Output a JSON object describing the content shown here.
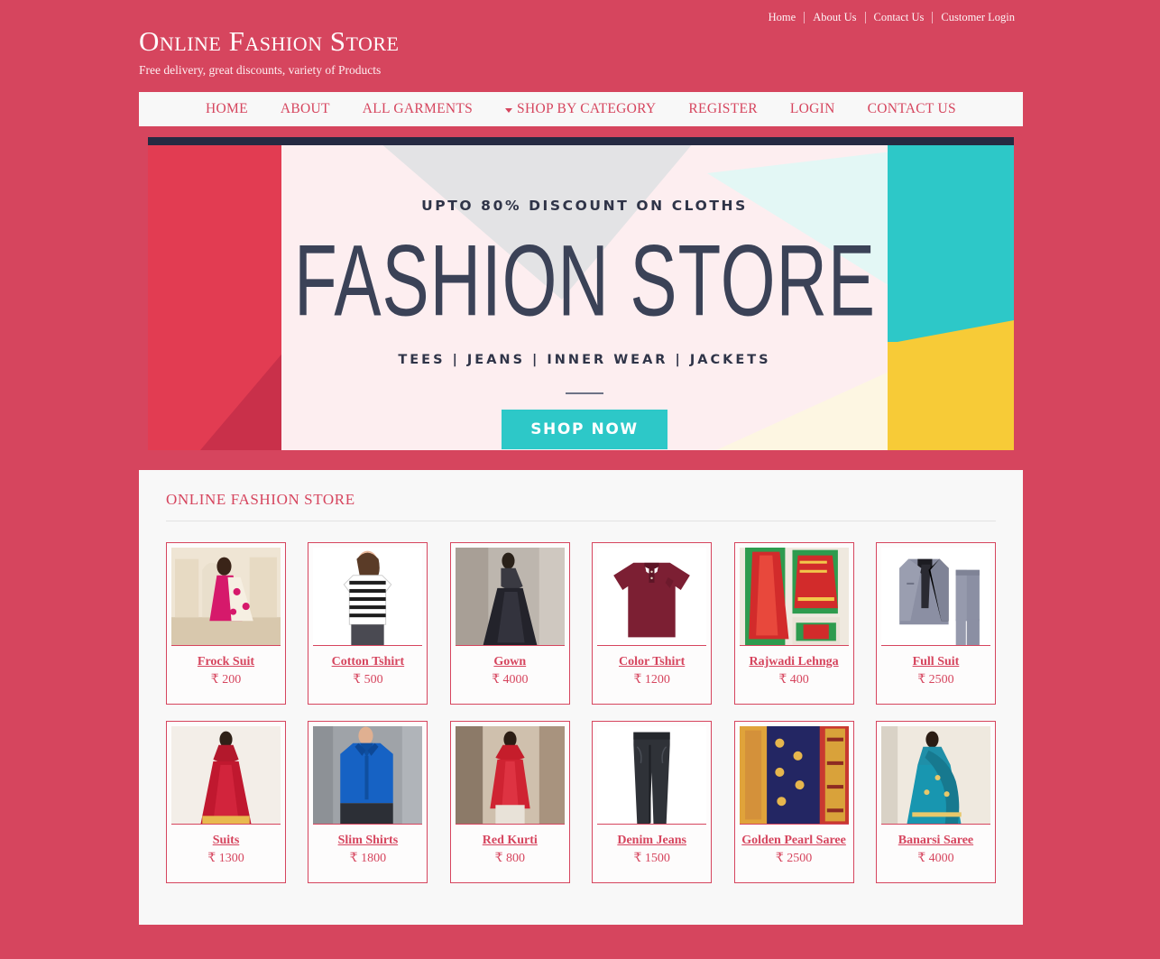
{
  "topbar": {
    "links": [
      {
        "label": "Home"
      },
      {
        "label": "About Us"
      },
      {
        "label": "Contact Us"
      },
      {
        "label": "Customer Login"
      }
    ]
  },
  "brand": {
    "title": "Online Fashion Store",
    "tagline": "Free delivery, great discounts, variety of Products"
  },
  "nav": {
    "items": [
      {
        "label": "HOME",
        "caret": false
      },
      {
        "label": "ABOUT",
        "caret": false
      },
      {
        "label": "ALL GARMENTS",
        "caret": false
      },
      {
        "label": "SHOP BY CATEGORY",
        "caret": true
      },
      {
        "label": "REGISTER",
        "caret": false
      },
      {
        "label": "LOGIN",
        "caret": false
      },
      {
        "label": "CONTACT US",
        "caret": false
      }
    ]
  },
  "banner": {
    "kicker": "UPTO 80% DISCOUNT ON CLOTHS",
    "headline": "FASHION STORE",
    "subline": "TEES  |  JEANS  |  INNER WEAR  |  JACKETS",
    "button": "SHOP NOW",
    "colors": {
      "navy": "#252a42",
      "red": "#e23c52",
      "teal": "#2dc8c8",
      "yellow": "#f7cb37",
      "pink": "#fdeef0"
    }
  },
  "section": {
    "title": "ONLINE FASHION STORE"
  },
  "products": [
    {
      "name": "Frock Suit",
      "price": "₹ 200"
    },
    {
      "name": "Cotton Tshirt",
      "price": "₹ 500"
    },
    {
      "name": "Gown",
      "price": "₹ 4000"
    },
    {
      "name": "Color Tshirt",
      "price": "₹ 1200"
    },
    {
      "name": "Rajwadi Lehnga",
      "price": "₹ 400"
    },
    {
      "name": "Full Suit",
      "price": "₹ 2500"
    },
    {
      "name": "Suits",
      "price": "₹ 1300"
    },
    {
      "name": "Slim Shirts",
      "price": "₹ 1800"
    },
    {
      "name": "Red Kurti",
      "price": "₹ 800"
    },
    {
      "name": "Denim Jeans",
      "price": "₹ 1500"
    },
    {
      "name": "Golden Pearl Saree",
      "price": "₹ 2500"
    },
    {
      "name": "Banarsi Saree",
      "price": "₹ 4000"
    }
  ],
  "theme": {
    "accent": "#d6455e",
    "panel": "#f8f8f8"
  }
}
